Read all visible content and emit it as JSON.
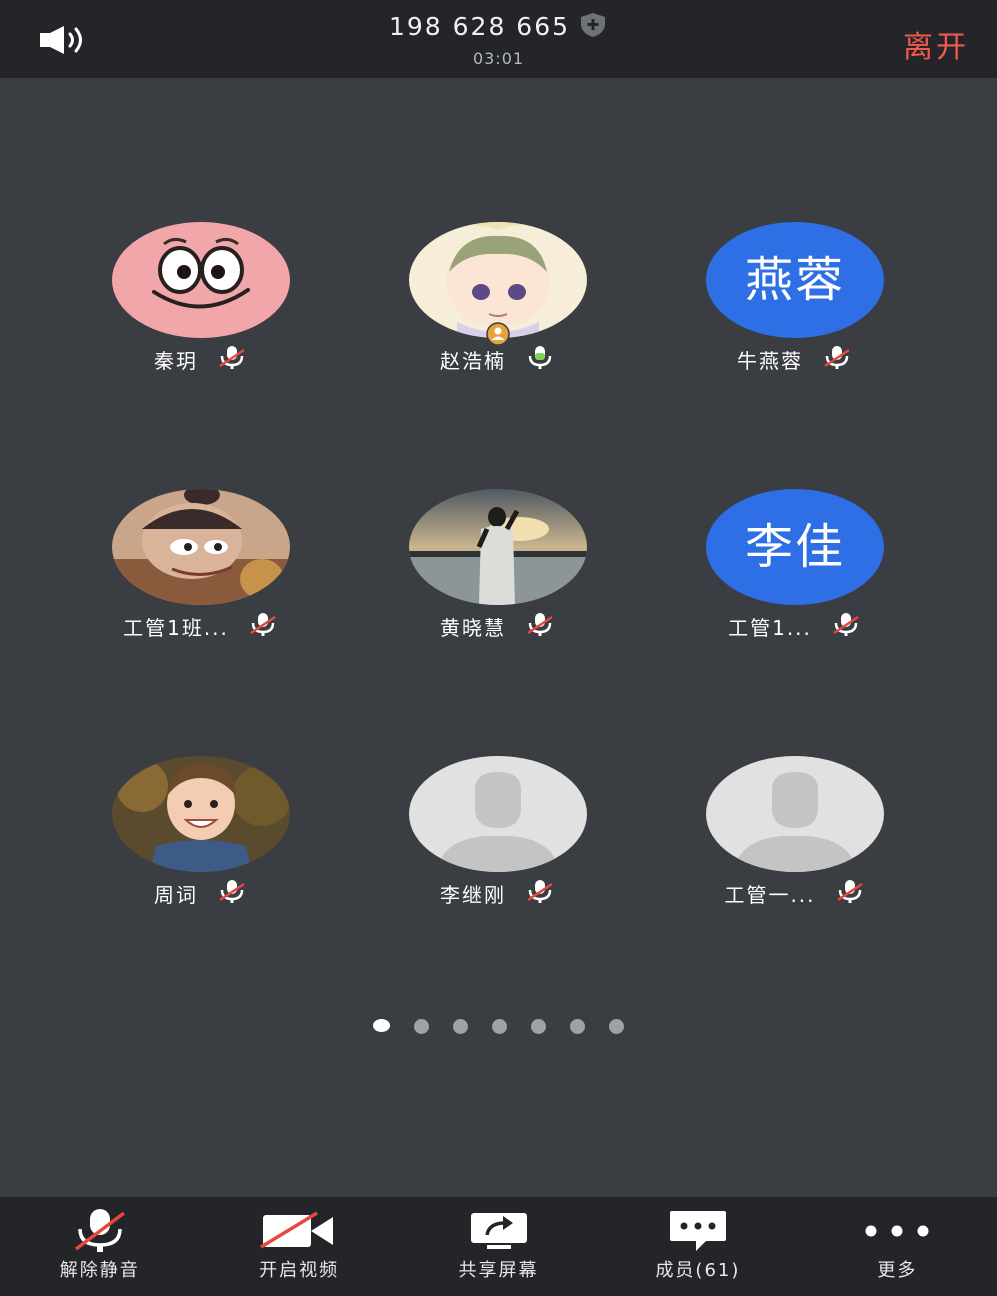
{
  "header": {
    "meeting_id": "198 628 665",
    "timer": "03:01",
    "leave_label": "离开"
  },
  "participants": [
    {
      "name": "秦玥",
      "mic": "muted",
      "avatar": "patrick-star-photo"
    },
    {
      "name": "赵浩楠",
      "mic": "active",
      "avatar": "anime-child-photo",
      "host": true
    },
    {
      "name": "牛燕蓉",
      "mic": "muted",
      "avatar_text": "燕蓉"
    },
    {
      "name": "工管1班...",
      "mic": "muted",
      "avatar": "cartoon-boy-photo"
    },
    {
      "name": "黄晓慧",
      "mic": "muted",
      "avatar": "sunset-lake-photo"
    },
    {
      "name": "工管1...",
      "mic": "muted",
      "avatar_text": "李佳"
    },
    {
      "name": "周词",
      "mic": "muted",
      "avatar": "toddler-photo"
    },
    {
      "name": "李继刚",
      "mic": "muted",
      "avatar": "default-person-icon"
    },
    {
      "name": "工管一...",
      "mic": "muted",
      "avatar": "default-person-icon"
    }
  ],
  "pagination": {
    "pages": 7,
    "current": 1
  },
  "toolbar": {
    "unmute": "解除静音",
    "video": "开启视频",
    "share": "共享屏幕",
    "members": "成员(61)",
    "more": "更多"
  },
  "colors": {
    "background": "#3a3d41",
    "bar": "#232528",
    "leave": "#ef5a4f",
    "text_avatar": "#2e6fe6",
    "mute_slash": "#e5483d",
    "speaking": "#7cd35a"
  }
}
